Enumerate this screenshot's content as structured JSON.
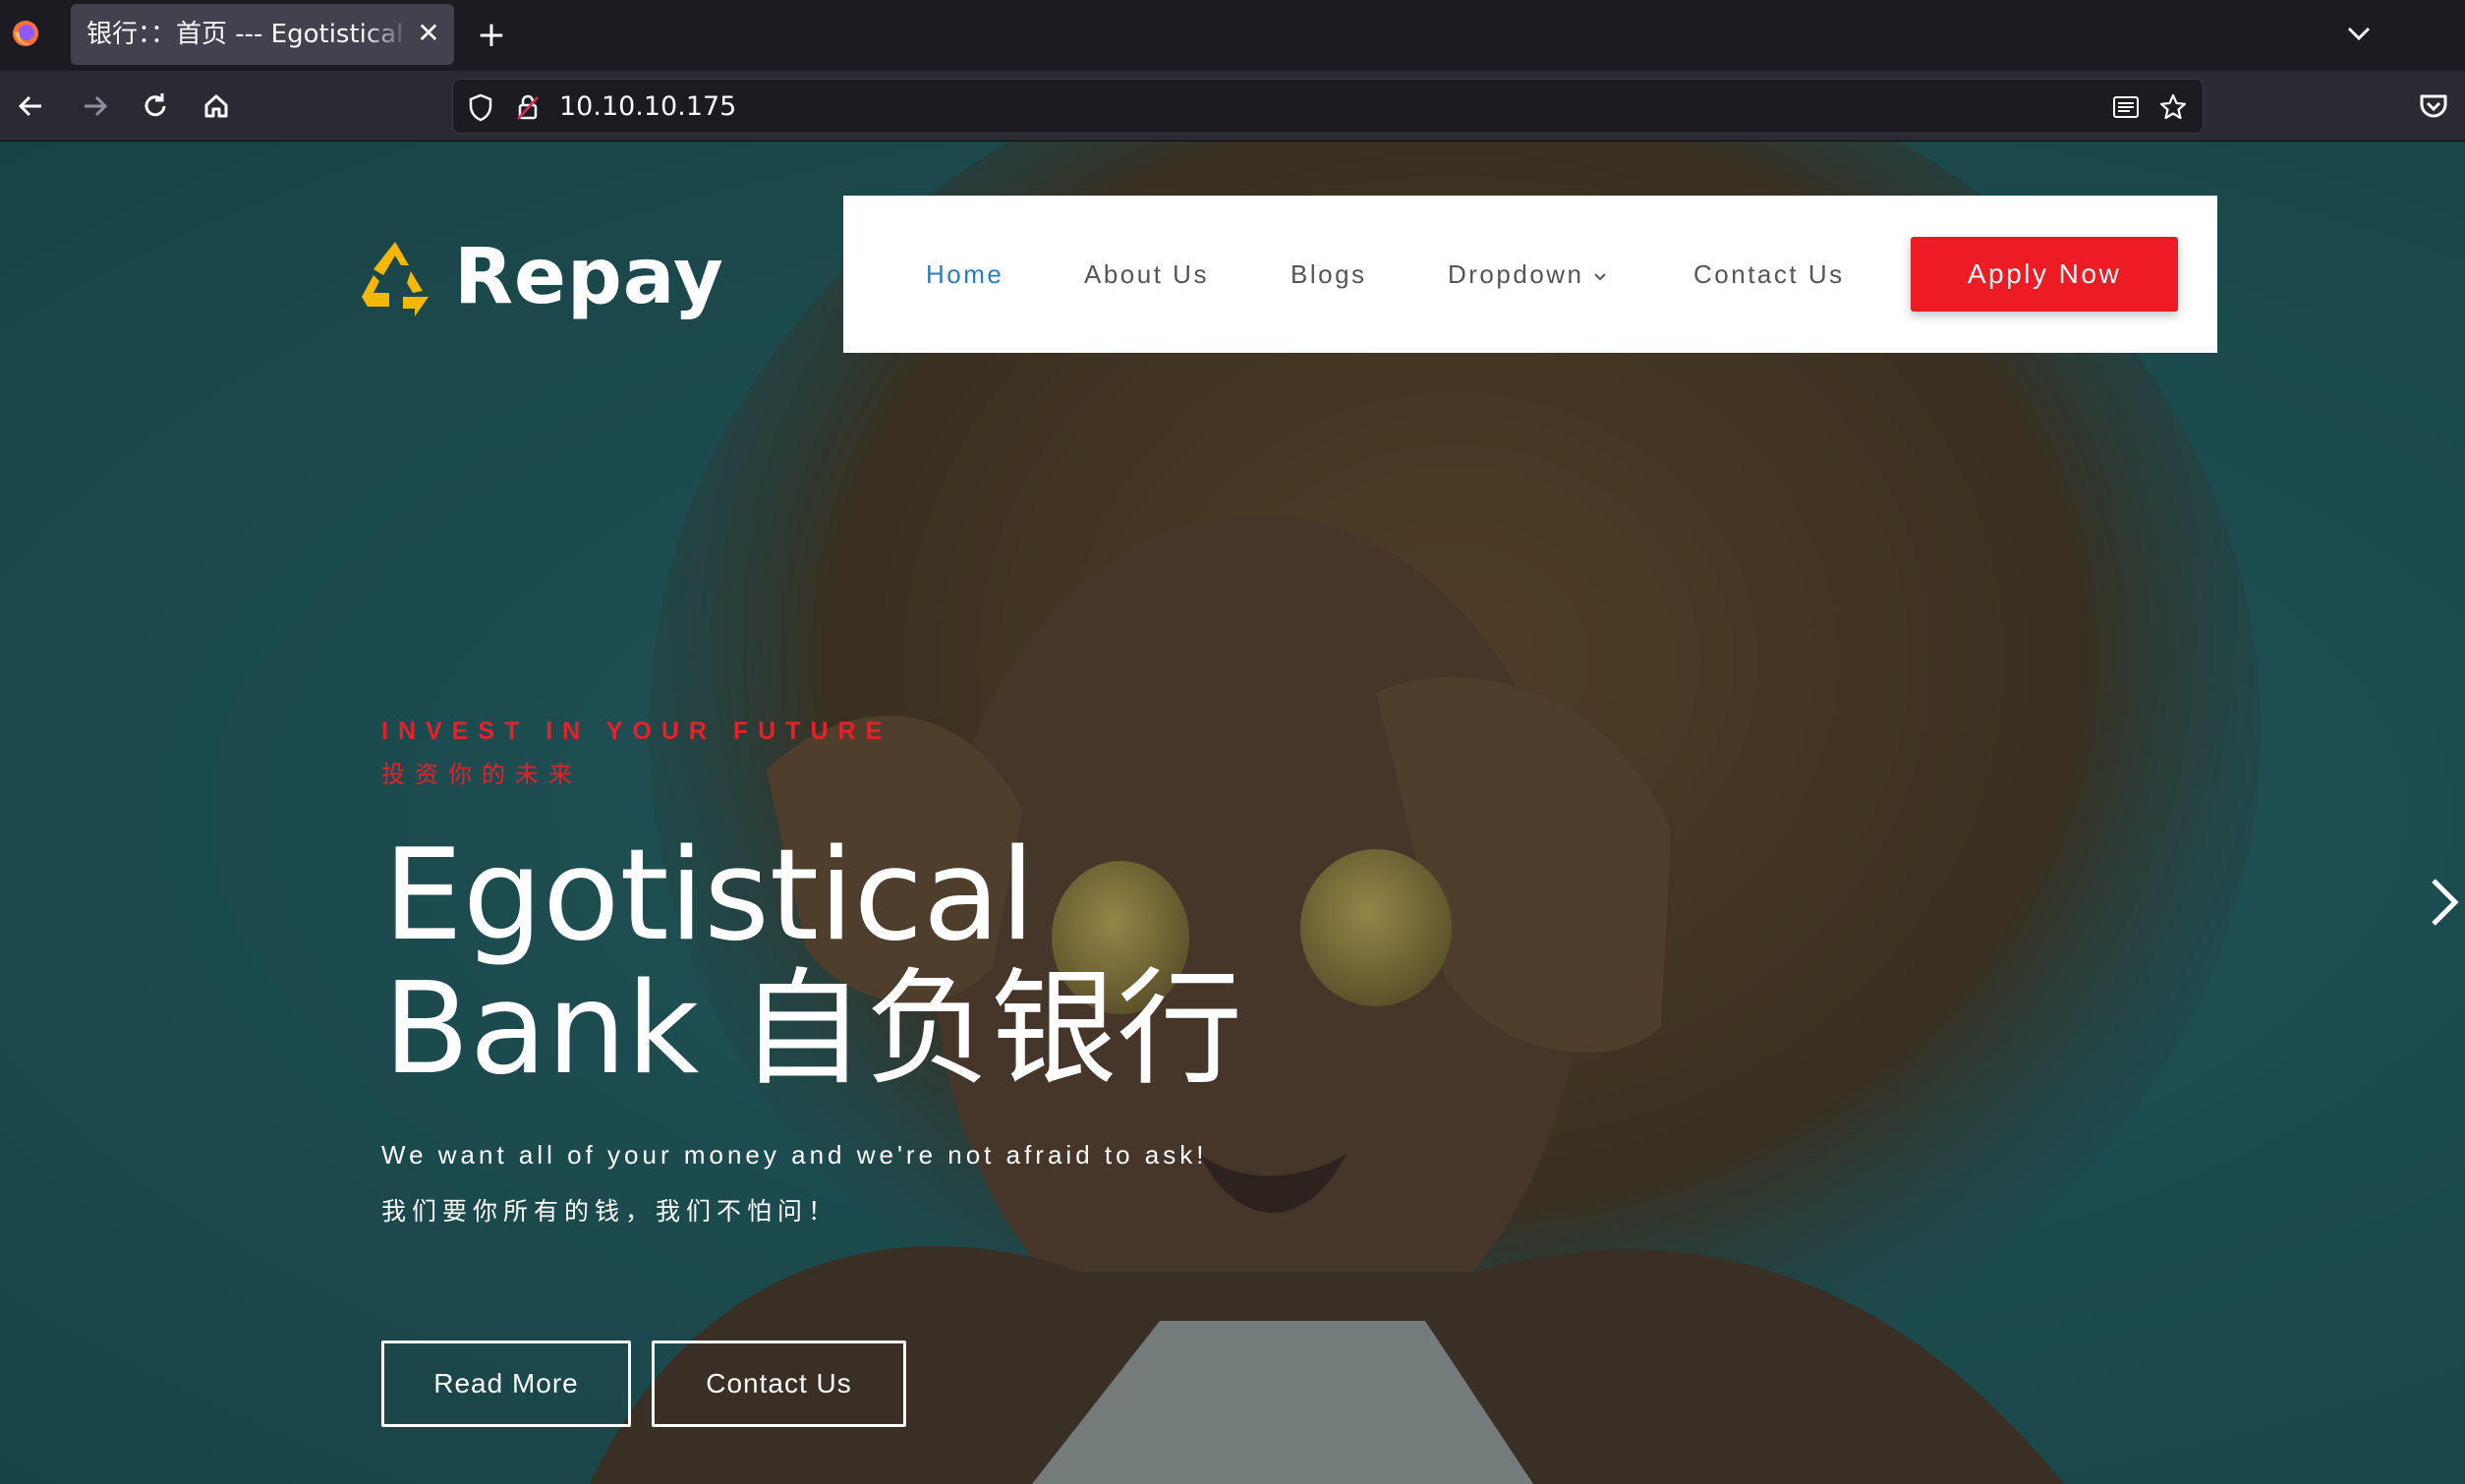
{
  "browser": {
    "tab_title": "银行：：首页 --- Egotistical Bank",
    "tab_close": "✕",
    "new_tab": "+",
    "url": "10.10.10.175"
  },
  "site": {
    "brand": "Repay",
    "menu": [
      {
        "label": "Home",
        "active": true
      },
      {
        "label": "About Us"
      },
      {
        "label": "Blogs"
      },
      {
        "label": "Dropdown"
      },
      {
        "label": "Contact Us"
      }
    ],
    "apply_button": "Apply Now",
    "hero": {
      "kicker": "INVEST IN YOUR FUTURE",
      "kicker_cn": "投资你的未来",
      "headline_line1": "Egotistical",
      "headline_line2": "Bank 自负银行",
      "subtitle": "We want all of your money and we're not afraid to ask!",
      "subtitle_cn": "我们要你所有的钱，我们不怕问！",
      "read_more": "Read More",
      "contact_us": "Contact Us"
    }
  },
  "colors": {
    "accent_red": "#ed1c24",
    "nav_active": "#2b7bbf",
    "hero_bg": "#23595c"
  },
  "icons": [
    "firefox-icon",
    "close-icon",
    "plus-icon",
    "chevron-down-icon",
    "back-icon",
    "forward-icon",
    "reload-icon",
    "home-icon",
    "shield-icon",
    "lock-icon",
    "reader-view-icon",
    "star-icon",
    "pocket-icon",
    "recycle-icon",
    "chevron-right-icon"
  ]
}
